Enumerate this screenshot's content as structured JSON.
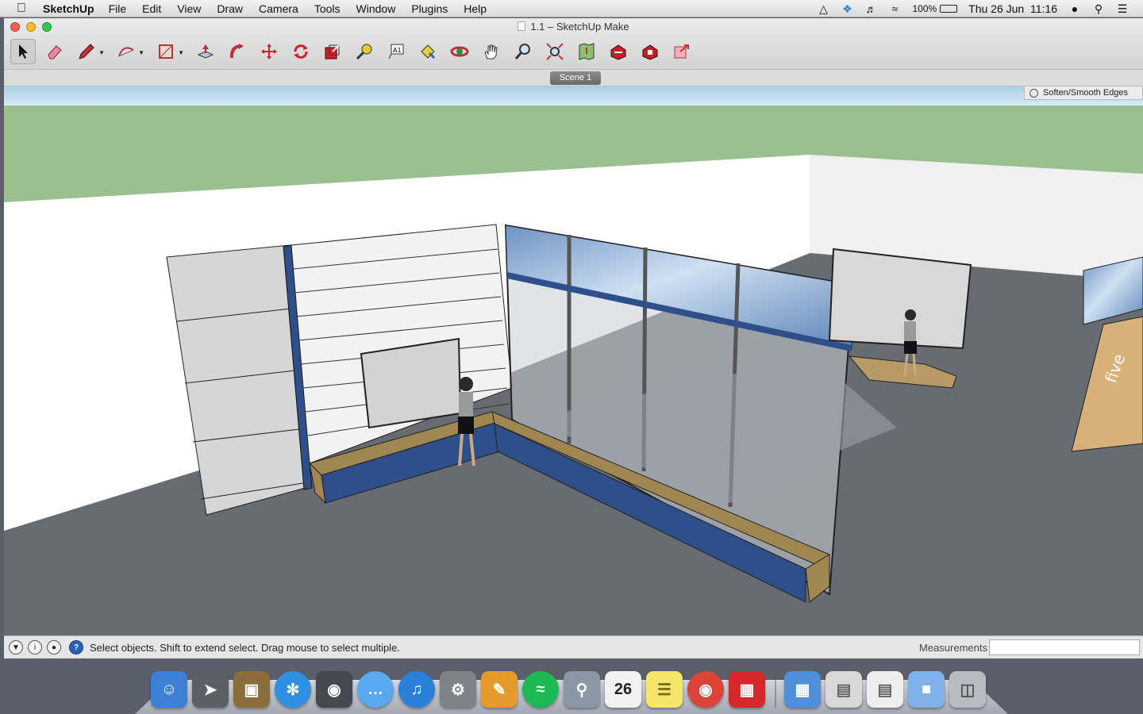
{
  "menubar": {
    "app_name": "SketchUp",
    "items": [
      "File",
      "Edit",
      "View",
      "Draw",
      "Camera",
      "Tools",
      "Window",
      "Plugins",
      "Help"
    ],
    "battery": "100%",
    "datetime": "Thu 26 Jun  11:16"
  },
  "window": {
    "title": "1.1 – SketchUp Make"
  },
  "toolbar": {
    "tools": [
      {
        "name": "select-tool",
        "icon": "arrow-icon"
      },
      {
        "name": "eraser-tool",
        "icon": "eraser-icon"
      },
      {
        "name": "pencil-tool",
        "icon": "pencil-icon"
      },
      {
        "name": "arc-tool",
        "icon": "arc-icon"
      },
      {
        "name": "rectangle-tool",
        "icon": "rectangle-icon"
      },
      {
        "name": "push-pull-tool",
        "icon": "push-pull-icon"
      },
      {
        "name": "follow-me-tool",
        "icon": "follow-me-icon"
      },
      {
        "name": "move-tool",
        "icon": "move-icon"
      },
      {
        "name": "rotate-tool",
        "icon": "rotate-icon"
      },
      {
        "name": "scale-tool",
        "icon": "scale-icon"
      },
      {
        "name": "tape-measure-tool",
        "icon": "tape-measure-icon"
      },
      {
        "name": "text-tool",
        "icon": "text-icon"
      },
      {
        "name": "paint-bucket-tool",
        "icon": "paint-bucket-icon"
      },
      {
        "name": "orbit-tool",
        "icon": "orbit-icon"
      },
      {
        "name": "pan-tool",
        "icon": "hand-icon"
      },
      {
        "name": "zoom-tool",
        "icon": "magnifier-icon"
      },
      {
        "name": "zoom-extents-tool",
        "icon": "zoom-extents-icon"
      },
      {
        "name": "add-location-tool",
        "icon": "map-icon"
      },
      {
        "name": "3d-warehouse-tool",
        "icon": "warehouse-icon"
      },
      {
        "name": "extension-warehouse-tool",
        "icon": "extension-icon"
      },
      {
        "name": "share-model-tool",
        "icon": "share-icon"
      }
    ]
  },
  "scenes": {
    "tab_label": "Scene 1"
  },
  "soften_panel": {
    "label": "Soften/Smooth Edges"
  },
  "status": {
    "text": "Select objects. Shift to extend select. Drag mouse to select multiple.",
    "measurements_label": "Measurements",
    "measurements_value": ""
  },
  "model_signage": {
    "logo_text": "five"
  },
  "dock": {
    "date_badge": "26",
    "apps": [
      {
        "name": "finder-icon",
        "color": "#3d7fd6"
      },
      {
        "name": "launchpad-icon",
        "color": "#5b5f66"
      },
      {
        "name": "photo-booth-icon",
        "color": "#8a6d3b"
      },
      {
        "name": "safari-icon",
        "color": "#2f8fe0"
      },
      {
        "name": "facetime-icon",
        "color": "#44484f"
      },
      {
        "name": "messages-icon",
        "color": "#58a9ee"
      },
      {
        "name": "itunes-icon",
        "color": "#2a7fd8"
      },
      {
        "name": "system-preferences-icon",
        "color": "#7f8388"
      },
      {
        "name": "pages-icon",
        "color": "#e59b2c"
      },
      {
        "name": "spotify-icon",
        "color": "#1db954"
      },
      {
        "name": "preview-icon",
        "color": "#8b97a6"
      },
      {
        "name": "calendar-icon",
        "color": "#f2f2f2"
      },
      {
        "name": "stickies-icon",
        "color": "#f5e66a"
      },
      {
        "name": "chrome-icon",
        "color": "#db4437"
      },
      {
        "name": "sketchup-icon",
        "color": "#d8262d"
      }
    ],
    "right_items": [
      {
        "name": "applications-folder-icon",
        "color": "#4f8fd9"
      },
      {
        "name": "document-stack-icon",
        "color": "#d8d8d8"
      },
      {
        "name": "doc-file-icon",
        "color": "#eeeeee"
      },
      {
        "name": "folder-icon",
        "color": "#7fb2e8"
      },
      {
        "name": "trash-icon",
        "color": "#b8bcc2"
      }
    ]
  }
}
